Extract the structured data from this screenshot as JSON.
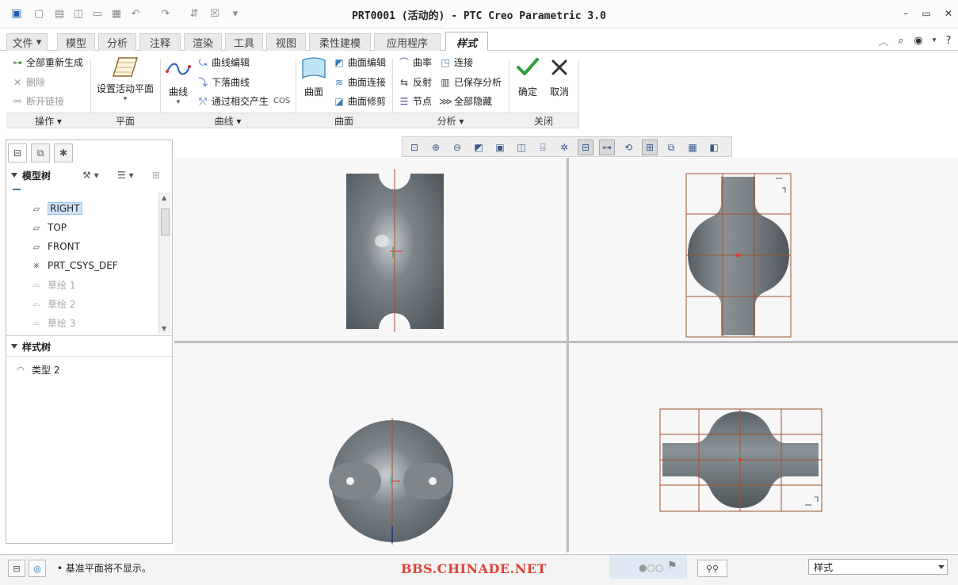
{
  "window": {
    "title": "PRT0001 (活动的) - PTC Creo Parametric 3.0"
  },
  "ribbon_tabs": [
    "文件",
    "模型",
    "分析",
    "注释",
    "渲染",
    "工具",
    "视图",
    "柔性建模",
    "应用程序",
    "样式"
  ],
  "active_tab": "样式",
  "ribbon": {
    "ops": {
      "regen_all": "全部重新生成",
      "delete": "删除",
      "break_link": "断开链接"
    },
    "plane": {
      "set_active_plane": "设置活动平面"
    },
    "curve": {
      "curve": "曲线",
      "curve_edit": "曲线编辑",
      "drop_curve": "下落曲线",
      "intersect_cos": "通过相交产生",
      "cos_suffix": "COS"
    },
    "surface": {
      "surface": "曲面",
      "surface_edit": "曲面编辑",
      "surface_connect": "曲面连接",
      "surface_trim": "曲面修剪"
    },
    "analysis": {
      "curvature": "曲率",
      "connect": "连接",
      "reflect": "反射",
      "saved_analysis": "已保存分析",
      "node": "节点",
      "hide_all": "全部隐藏"
    },
    "close": {
      "ok": "确定",
      "cancel": "取消"
    },
    "groups": {
      "ops": "操作",
      "plane": "平面",
      "curve": "曲线",
      "surface": "曲面",
      "analysis": "分析",
      "close": "关闭"
    }
  },
  "model_tree": {
    "header": "模型树",
    "items": [
      {
        "label": "RIGHT",
        "icon": "datum-plane-icon",
        "selected": true
      },
      {
        "label": "TOP",
        "icon": "datum-plane-icon"
      },
      {
        "label": "FRONT",
        "icon": "datum-plane-icon"
      },
      {
        "label": "PRT_CSYS_DEF",
        "icon": "csys-icon"
      },
      {
        "label": "草绘 1",
        "icon": "sketch-icon",
        "dim": true
      },
      {
        "label": "草绘 2",
        "icon": "sketch-icon",
        "dim": true
      },
      {
        "label": "草绘 3",
        "icon": "sketch-icon",
        "dim": true
      }
    ]
  },
  "style_tree": {
    "header": "样式树",
    "items": [
      {
        "label": "类型 2",
        "icon": "surface-icon"
      }
    ]
  },
  "status": {
    "message": "基准平面将不显示。",
    "watermark": "BBS.CHINADE.NET",
    "filter_value": "样式"
  },
  "colors": {
    "model_body": "#6d7479",
    "grid_lines": "#a0522d",
    "axis_red": "#e53935",
    "axis_green": "#43a047",
    "viewport_bg": "#f7f7f7"
  }
}
